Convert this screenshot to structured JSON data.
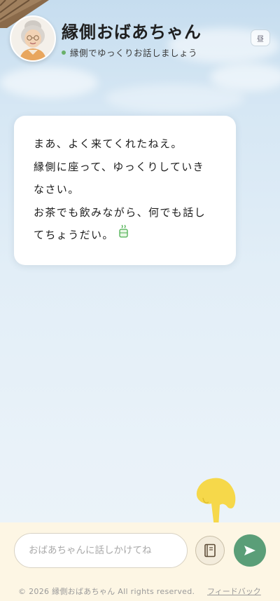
{
  "header": {
    "title": "縁側おばあちゃん",
    "subtitle": "縁側でゆっくりお話しましょう",
    "time_badge": "昼"
  },
  "message": {
    "lines": [
      "まあ、よく来てくれたねえ。",
      "縁側に座って、ゆっくりしていき",
      "なさい。",
      "お茶でも飲みながら、何でも話し",
      "てちょうだい。"
    ],
    "trailing_icon": "tea-icon"
  },
  "composer": {
    "placeholder": "おばあちゃんに話しかけてね",
    "book_icon": "book-icon",
    "send_icon": "send-icon"
  },
  "footer": {
    "copyright": "© 2026 縁側おばあちゃん All rights reserved.",
    "feedback": "フィードバック"
  },
  "colors": {
    "accent": "#5a9e78",
    "status_dot": "#6ab06a",
    "footer_bg": "#fdf6e4",
    "pointer": "#f6d84a"
  }
}
